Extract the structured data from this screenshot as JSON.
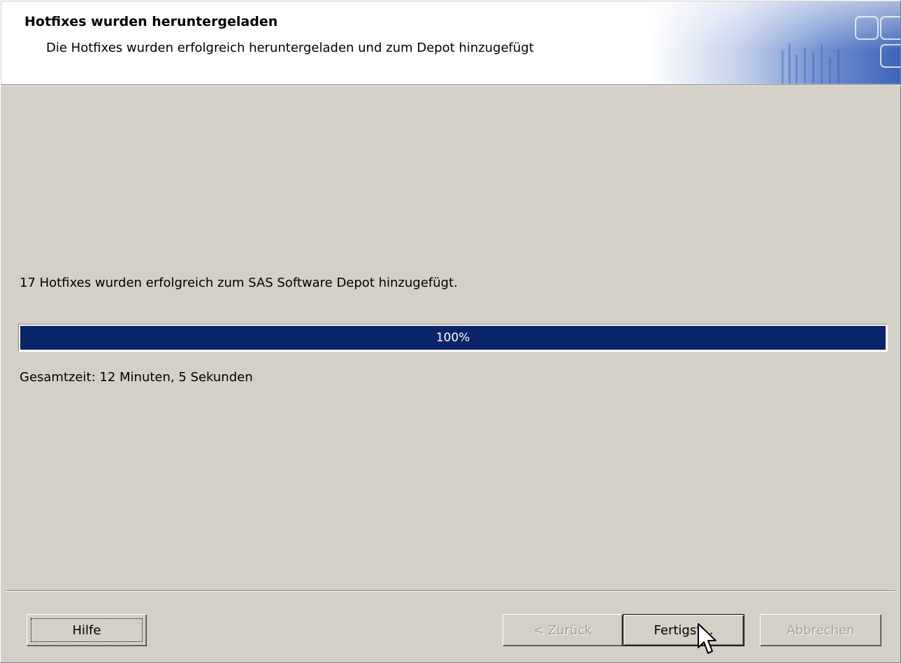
{
  "header": {
    "title": "Hotfixes wurden heruntergeladen",
    "subtitle": "Die Hotfixes wurden erfolgreich heruntergeladen und zum Depot hinzugefügt"
  },
  "main": {
    "status_message": "17 Hotfixes wurden erfolgreich zum SAS Software Depot hinzugefügt.",
    "progress": {
      "label": "100%",
      "value": 100
    },
    "total_time": "Gesamtzeit: 12 Minuten, 5 Sekunden"
  },
  "buttons": {
    "help": "Hilfe",
    "back": "< Zurück",
    "finish": "Fertigst...",
    "cancel": "Abbrechen"
  },
  "icons": {
    "header_art": "decorative-squares-icon",
    "cursor": "mouse-pointer-icon"
  },
  "colors": {
    "progress_fill": "#0a246a",
    "dialog_background": "#d4d0c8"
  }
}
